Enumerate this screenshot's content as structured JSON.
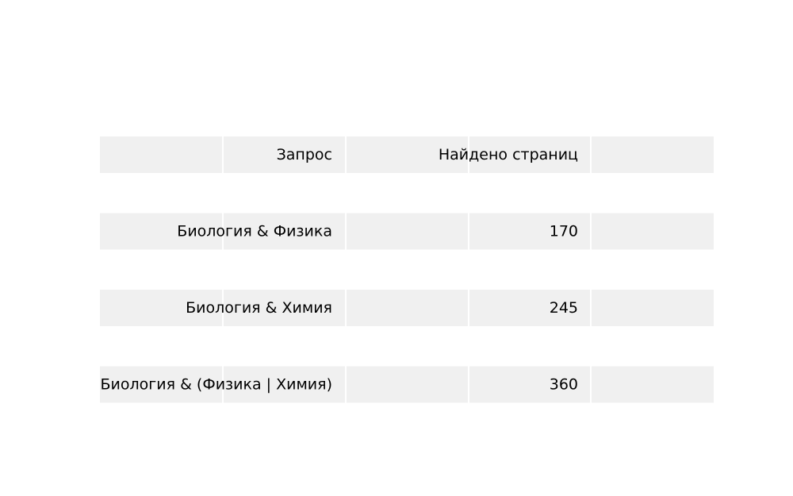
{
  "chart_data": {
    "type": "table",
    "columns": [
      "Запрос",
      "Найдено страниц"
    ],
    "rows": [
      [
        "Биология & Физика",
        "170"
      ],
      [
        "Биология & Химия",
        "245"
      ],
      [
        "Биология & (Физика | Химия)",
        "360"
      ]
    ],
    "grid": true
  },
  "colors": {
    "band": "#f0f0f0",
    "divider": "#ffffff",
    "text": "#000000",
    "background": "#ffffff"
  }
}
